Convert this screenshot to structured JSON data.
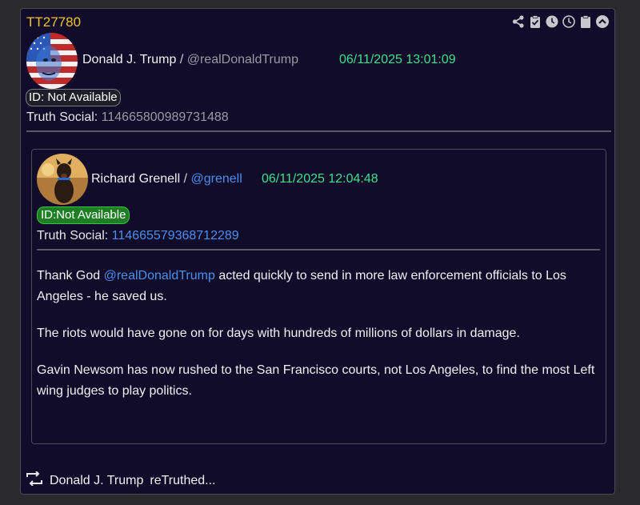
{
  "post": {
    "id": "TT27780",
    "author_name": "Donald J. Trump",
    "separator": " / ",
    "author_handle": "@realDonaldTrump",
    "timestamp": "06/11/2025 13:01:09",
    "id_pill": "ID: Not Available",
    "platform_label": "Truth Social:",
    "platform_id": "114665800989731488",
    "avatar_icon": "flag-face-avatar"
  },
  "toolbar": {
    "icons": [
      "share-icon",
      "clipboard-check-icon",
      "clock-filled-icon",
      "clock-outline-icon",
      "clipboard-icon",
      "collapse-icon"
    ]
  },
  "quoted": {
    "author_name": "Richard Grenell",
    "separator": " / ",
    "author_handle": "@grenell",
    "timestamp": "06/11/2025 12:04:48",
    "id_pill": "ID:Not Available",
    "platform_label": "Truth Social:",
    "platform_id": "114665579368712289",
    "avatar_icon": "dog-avatar",
    "body": {
      "p1_pre": "Thank God ",
      "p1_mention": "@realDonaldTrump",
      "p1_post": " acted quickly to send in more law enforcement officials to Los Angeles - he saved us.",
      "p2": "The riots would have gone on for days with hundreds of millions of dollars in damage.",
      "p3": "Gavin Newsom has now rushed to the San Francisco courts, not Los Angeles, to find the most Left wing judges to play politics."
    }
  },
  "retruth": {
    "name": "Donald J. Trump",
    "action": "reTruthed..."
  },
  "colors": {
    "post_id": "#f2c230",
    "timestamp": "#3ee08a",
    "link": "#4a8ff0",
    "card_bg": "#100c2a",
    "pill_green": "#1e7e24"
  }
}
